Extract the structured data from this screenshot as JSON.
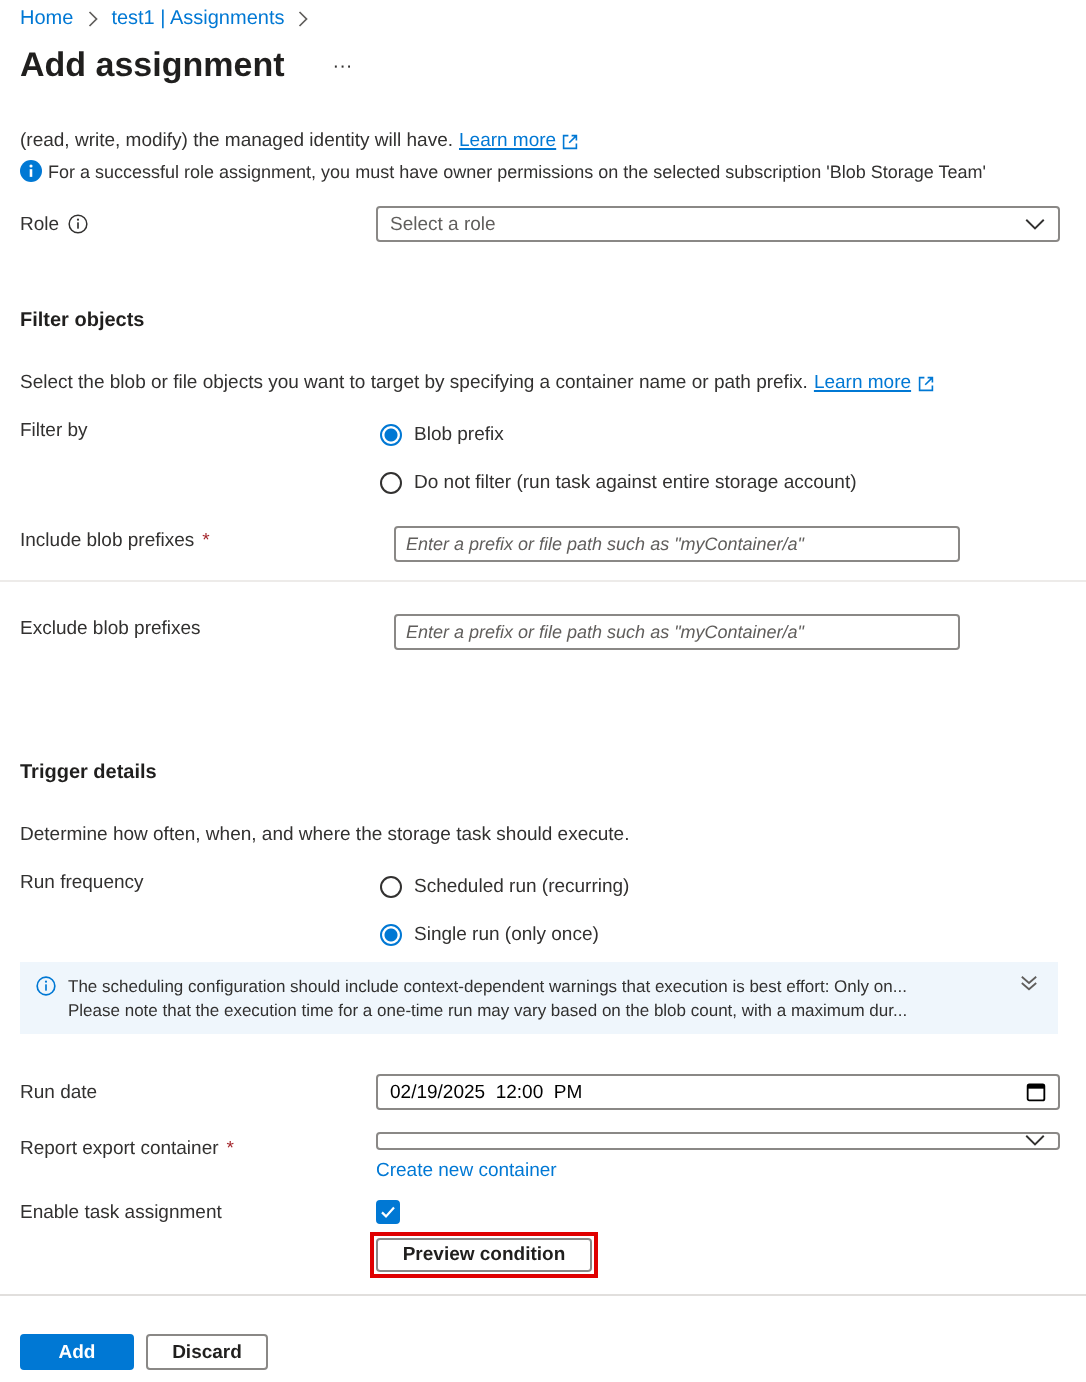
{
  "breadcrumb": [
    "Home",
    "test1 | Assignments"
  ],
  "title": "Add assignment",
  "more": "···",
  "intro": {
    "text": "(read, write, modify) the managed identity will have.",
    "link": "Learn more"
  },
  "notice": "For a successful role assignment, you must have owner permissions on the selected subscription 'Blob Storage Team'",
  "role": {
    "label": "Role",
    "placeholder": "Select a role"
  },
  "filter": {
    "heading": "Filter objects",
    "description": "Select the blob or file objects you want to target by specifying a container name or path prefix.",
    "link": "Learn more",
    "filter_by": {
      "label": "Filter by",
      "options": [
        {
          "label": "Blob prefix",
          "selected": true
        },
        {
          "label": "Do not filter (run task against entire storage account)",
          "selected": false
        }
      ]
    },
    "include": {
      "label": "Include blob prefixes",
      "required_mark": "*",
      "placeholder": "Enter a prefix or file path such as \"myContainer/a\""
    },
    "exclude": {
      "label": "Exclude blob prefixes",
      "placeholder": "Enter a prefix or file path such as \"myContainer/a\""
    }
  },
  "trigger": {
    "heading": "Trigger details",
    "description": "Determine how often, when, and where the storage task should execute.",
    "run_frequency": {
      "label": "Run frequency",
      "options": [
        {
          "label": "Scheduled run (recurring)",
          "selected": false
        },
        {
          "label": "Single run (only once)",
          "selected": true
        }
      ]
    },
    "banner": {
      "lines": [
        "The scheduling configuration should include context-dependent warnings that execution is best effort: Only on...",
        "Please note that the execution time for a one-time run may vary based on the blob count, with a maximum dur..."
      ],
      "expanded": false
    },
    "run_date": {
      "label": "Run date",
      "value": "02/19/2025  12:00  PM"
    },
    "report_container": {
      "label": "Report export container",
      "required_mark": "*",
      "link": "Create new container"
    },
    "enable": {
      "label": "Enable task assignment",
      "checked": true
    },
    "preview": {
      "label": "Preview condition",
      "highlighted": true
    }
  },
  "footer": [
    {
      "label": "Add",
      "kind": "primary"
    },
    {
      "label": "Discard",
      "kind": "secondary"
    }
  ]
}
